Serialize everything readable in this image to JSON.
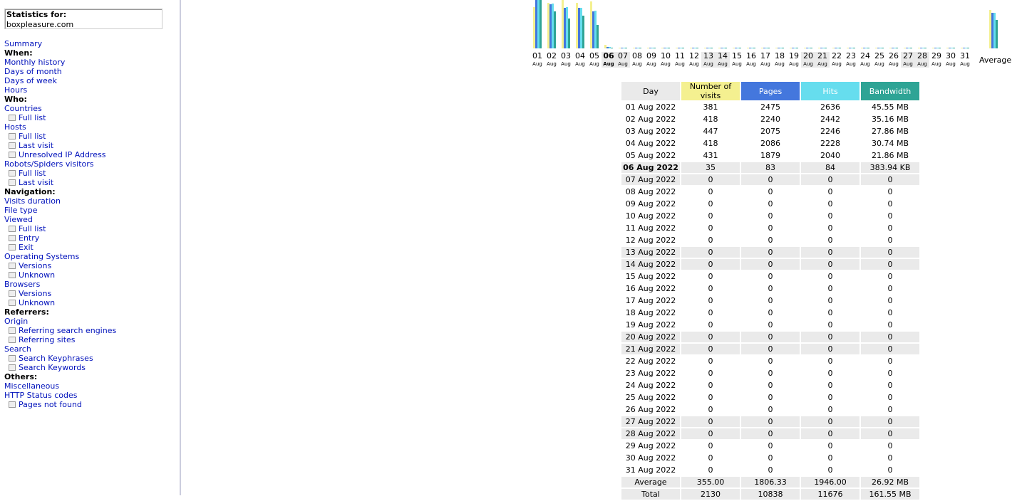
{
  "stats": {
    "label": "Statistics for:",
    "site": "boxpleasure.com"
  },
  "menu": [
    {
      "type": "link",
      "label": "Summary"
    },
    {
      "type": "cat",
      "label": "When:"
    },
    {
      "type": "link",
      "label": "Monthly history"
    },
    {
      "type": "link",
      "label": "Days of month"
    },
    {
      "type": "link",
      "label": "Days of week"
    },
    {
      "type": "link",
      "label": "Hours"
    },
    {
      "type": "cat",
      "label": "Who:"
    },
    {
      "type": "link",
      "label": "Countries"
    },
    {
      "type": "sub",
      "label": "Full list"
    },
    {
      "type": "link",
      "label": "Hosts"
    },
    {
      "type": "sub",
      "label": "Full list"
    },
    {
      "type": "sub",
      "label": "Last visit"
    },
    {
      "type": "sub",
      "label": "Unresolved IP Address"
    },
    {
      "type": "link",
      "label": "Robots/Spiders visitors"
    },
    {
      "type": "sub",
      "label": "Full list"
    },
    {
      "type": "sub",
      "label": "Last visit"
    },
    {
      "type": "cat",
      "label": "Navigation:"
    },
    {
      "type": "link",
      "label": "Visits duration"
    },
    {
      "type": "link",
      "label": "File type"
    },
    {
      "type": "link",
      "label": "Viewed"
    },
    {
      "type": "sub",
      "label": "Full list"
    },
    {
      "type": "sub",
      "label": "Entry"
    },
    {
      "type": "sub",
      "label": "Exit"
    },
    {
      "type": "link",
      "label": "Operating Systems"
    },
    {
      "type": "sub",
      "label": "Versions"
    },
    {
      "type": "sub",
      "label": "Unknown"
    },
    {
      "type": "link",
      "label": "Browsers"
    },
    {
      "type": "sub",
      "label": "Versions"
    },
    {
      "type": "sub",
      "label": "Unknown"
    },
    {
      "type": "cat",
      "label": "Referrers:"
    },
    {
      "type": "link",
      "label": "Origin"
    },
    {
      "type": "sub",
      "label": "Referring search engines"
    },
    {
      "type": "sub",
      "label": "Referring sites"
    },
    {
      "type": "link",
      "label": "Search"
    },
    {
      "type": "sub",
      "label": "Search Keyphrases"
    },
    {
      "type": "sub",
      "label": "Search Keywords"
    },
    {
      "type": "cat",
      "label": "Others:"
    },
    {
      "type": "link",
      "label": "Miscellaneous"
    },
    {
      "type": "link",
      "label": "HTTP Status codes"
    },
    {
      "type": "sub",
      "label": "Pages not found"
    }
  ],
  "colors": {
    "visits": "#f4f090",
    "pages": "#4477dd",
    "hits": "#66ddee",
    "bandwidth": "#2ea495"
  },
  "headers": [
    "Day",
    "Number of visits",
    "Pages",
    "Hits",
    "Bandwidth"
  ],
  "month_abbr": "Aug",
  "average_label": "Average",
  "chart_data": {
    "type": "bar",
    "categories": [
      "01",
      "02",
      "03",
      "04",
      "05",
      "06",
      "07",
      "08",
      "09",
      "10",
      "11",
      "12",
      "13",
      "14",
      "15",
      "16",
      "17",
      "18",
      "19",
      "20",
      "21",
      "22",
      "23",
      "24",
      "25",
      "26",
      "27",
      "28",
      "29",
      "30",
      "31"
    ],
    "weekend": [
      "06",
      "07",
      "13",
      "14",
      "20",
      "21",
      "27",
      "28"
    ],
    "today": "06",
    "series": [
      {
        "name": "Number of visits",
        "values": [
          381,
          418,
          447,
          418,
          431,
          35,
          0,
          0,
          0,
          0,
          0,
          0,
          0,
          0,
          0,
          0,
          0,
          0,
          0,
          0,
          0,
          0,
          0,
          0,
          0,
          0,
          0,
          0,
          0,
          0,
          0
        ]
      },
      {
        "name": "Pages",
        "values": [
          2475,
          2240,
          2075,
          2086,
          1879,
          83,
          0,
          0,
          0,
          0,
          0,
          0,
          0,
          0,
          0,
          0,
          0,
          0,
          0,
          0,
          0,
          0,
          0,
          0,
          0,
          0,
          0,
          0,
          0,
          0,
          0
        ]
      },
      {
        "name": "Hits",
        "values": [
          2636,
          2442,
          2246,
          2228,
          2040,
          84,
          0,
          0,
          0,
          0,
          0,
          0,
          0,
          0,
          0,
          0,
          0,
          0,
          0,
          0,
          0,
          0,
          0,
          0,
          0,
          0,
          0,
          0,
          0,
          0,
          0
        ]
      },
      {
        "name": "Bandwidth",
        "values": [
          45.55,
          35.16,
          27.86,
          30.74,
          21.86,
          0.37,
          0,
          0,
          0,
          0,
          0,
          0,
          0,
          0,
          0,
          0,
          0,
          0,
          0,
          0,
          0,
          0,
          0,
          0,
          0,
          0,
          0,
          0,
          0,
          0,
          0
        ]
      }
    ],
    "average": {
      "Number of visits": 355.0,
      "Pages": 1806.33,
      "Hits": 1946.0,
      "Bandwidth": 26.92
    }
  },
  "rows": [
    [
      "01 Aug 2022",
      "381",
      "2475",
      "2636",
      "45.55 MB"
    ],
    [
      "02 Aug 2022",
      "418",
      "2240",
      "2442",
      "35.16 MB"
    ],
    [
      "03 Aug 2022",
      "447",
      "2075",
      "2246",
      "27.86 MB"
    ],
    [
      "04 Aug 2022",
      "418",
      "2086",
      "2228",
      "30.74 MB"
    ],
    [
      "05 Aug 2022",
      "431",
      "1879",
      "2040",
      "21.86 MB"
    ],
    [
      "06 Aug 2022",
      "35",
      "83",
      "84",
      "383.94 KB"
    ],
    [
      "07 Aug 2022",
      "0",
      "0",
      "0",
      "0"
    ],
    [
      "08 Aug 2022",
      "0",
      "0",
      "0",
      "0"
    ],
    [
      "09 Aug 2022",
      "0",
      "0",
      "0",
      "0"
    ],
    [
      "10 Aug 2022",
      "0",
      "0",
      "0",
      "0"
    ],
    [
      "11 Aug 2022",
      "0",
      "0",
      "0",
      "0"
    ],
    [
      "12 Aug 2022",
      "0",
      "0",
      "0",
      "0"
    ],
    [
      "13 Aug 2022",
      "0",
      "0",
      "0",
      "0"
    ],
    [
      "14 Aug 2022",
      "0",
      "0",
      "0",
      "0"
    ],
    [
      "15 Aug 2022",
      "0",
      "0",
      "0",
      "0"
    ],
    [
      "16 Aug 2022",
      "0",
      "0",
      "0",
      "0"
    ],
    [
      "17 Aug 2022",
      "0",
      "0",
      "0",
      "0"
    ],
    [
      "18 Aug 2022",
      "0",
      "0",
      "0",
      "0"
    ],
    [
      "19 Aug 2022",
      "0",
      "0",
      "0",
      "0"
    ],
    [
      "20 Aug 2022",
      "0",
      "0",
      "0",
      "0"
    ],
    [
      "21 Aug 2022",
      "0",
      "0",
      "0",
      "0"
    ],
    [
      "22 Aug 2022",
      "0",
      "0",
      "0",
      "0"
    ],
    [
      "23 Aug 2022",
      "0",
      "0",
      "0",
      "0"
    ],
    [
      "24 Aug 2022",
      "0",
      "0",
      "0",
      "0"
    ],
    [
      "25 Aug 2022",
      "0",
      "0",
      "0",
      "0"
    ],
    [
      "26 Aug 2022",
      "0",
      "0",
      "0",
      "0"
    ],
    [
      "27 Aug 2022",
      "0",
      "0",
      "0",
      "0"
    ],
    [
      "28 Aug 2022",
      "0",
      "0",
      "0",
      "0"
    ],
    [
      "29 Aug 2022",
      "0",
      "0",
      "0",
      "0"
    ],
    [
      "30 Aug 2022",
      "0",
      "0",
      "0",
      "0"
    ],
    [
      "31 Aug 2022",
      "0",
      "0",
      "0",
      "0"
    ]
  ],
  "footer": [
    [
      "Average",
      "355.00",
      "1806.33",
      "1946.00",
      "26.92 MB"
    ],
    [
      "Total",
      "2130",
      "10838",
      "11676",
      "161.55 MB"
    ]
  ]
}
